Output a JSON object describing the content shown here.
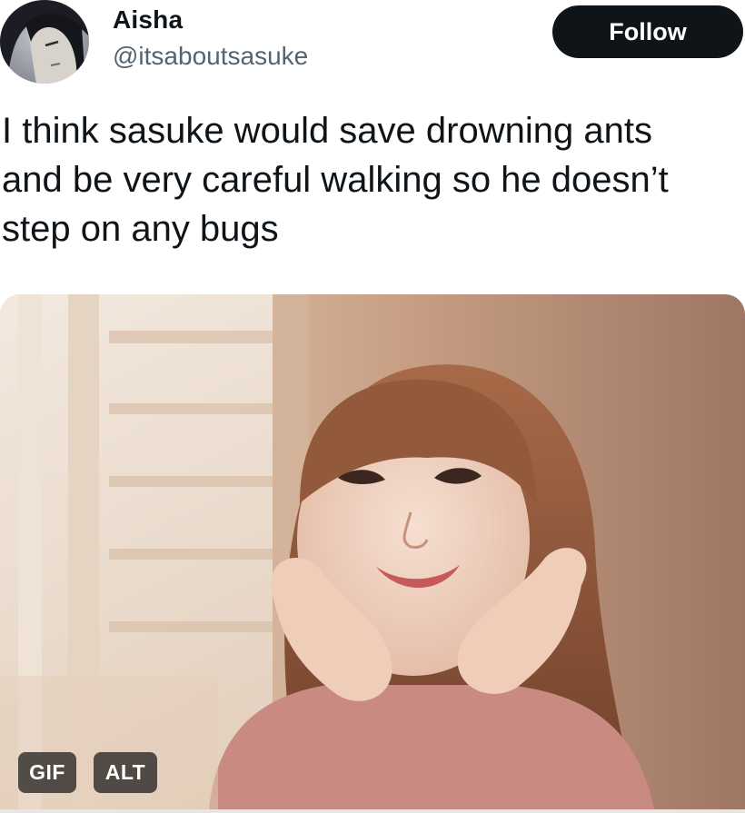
{
  "author": {
    "display_name": "Aisha",
    "handle": "@itsaboutsasuke"
  },
  "actions": {
    "follow_label": "Follow"
  },
  "tweet": {
    "text": "I think sasuke would save drowning ants\nand be very careful walking so he doesn’t\nstep on any bugs"
  },
  "media": {
    "type_badge": "GIF",
    "alt_badge": "ALT"
  },
  "colors": {
    "text_primary": "#0f1419",
    "text_secondary": "#536471",
    "follow_button_bg": "#0f1419",
    "follow_button_text": "#ffffff"
  }
}
